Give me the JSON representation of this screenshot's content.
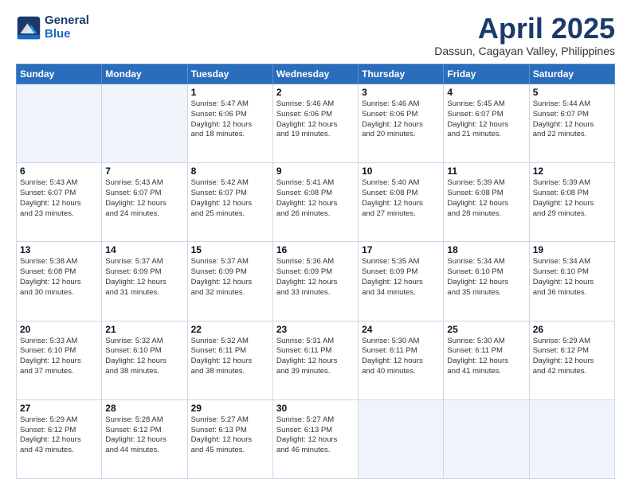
{
  "header": {
    "logo_line1": "General",
    "logo_line2": "Blue",
    "month": "April 2025",
    "location": "Dassun, Cagayan Valley, Philippines"
  },
  "weekdays": [
    "Sunday",
    "Monday",
    "Tuesday",
    "Wednesday",
    "Thursday",
    "Friday",
    "Saturday"
  ],
  "weeks": [
    [
      {
        "day": "",
        "info": ""
      },
      {
        "day": "",
        "info": ""
      },
      {
        "day": "1",
        "info": "Sunrise: 5:47 AM\nSunset: 6:06 PM\nDaylight: 12 hours\nand 18 minutes."
      },
      {
        "day": "2",
        "info": "Sunrise: 5:46 AM\nSunset: 6:06 PM\nDaylight: 12 hours\nand 19 minutes."
      },
      {
        "day": "3",
        "info": "Sunrise: 5:46 AM\nSunset: 6:06 PM\nDaylight: 12 hours\nand 20 minutes."
      },
      {
        "day": "4",
        "info": "Sunrise: 5:45 AM\nSunset: 6:07 PM\nDaylight: 12 hours\nand 21 minutes."
      },
      {
        "day": "5",
        "info": "Sunrise: 5:44 AM\nSunset: 6:07 PM\nDaylight: 12 hours\nand 22 minutes."
      }
    ],
    [
      {
        "day": "6",
        "info": "Sunrise: 5:43 AM\nSunset: 6:07 PM\nDaylight: 12 hours\nand 23 minutes."
      },
      {
        "day": "7",
        "info": "Sunrise: 5:43 AM\nSunset: 6:07 PM\nDaylight: 12 hours\nand 24 minutes."
      },
      {
        "day": "8",
        "info": "Sunrise: 5:42 AM\nSunset: 6:07 PM\nDaylight: 12 hours\nand 25 minutes."
      },
      {
        "day": "9",
        "info": "Sunrise: 5:41 AM\nSunset: 6:08 PM\nDaylight: 12 hours\nand 26 minutes."
      },
      {
        "day": "10",
        "info": "Sunrise: 5:40 AM\nSunset: 6:08 PM\nDaylight: 12 hours\nand 27 minutes."
      },
      {
        "day": "11",
        "info": "Sunrise: 5:39 AM\nSunset: 6:08 PM\nDaylight: 12 hours\nand 28 minutes."
      },
      {
        "day": "12",
        "info": "Sunrise: 5:39 AM\nSunset: 6:08 PM\nDaylight: 12 hours\nand 29 minutes."
      }
    ],
    [
      {
        "day": "13",
        "info": "Sunrise: 5:38 AM\nSunset: 6:08 PM\nDaylight: 12 hours\nand 30 minutes."
      },
      {
        "day": "14",
        "info": "Sunrise: 5:37 AM\nSunset: 6:09 PM\nDaylight: 12 hours\nand 31 minutes."
      },
      {
        "day": "15",
        "info": "Sunrise: 5:37 AM\nSunset: 6:09 PM\nDaylight: 12 hours\nand 32 minutes."
      },
      {
        "day": "16",
        "info": "Sunrise: 5:36 AM\nSunset: 6:09 PM\nDaylight: 12 hours\nand 33 minutes."
      },
      {
        "day": "17",
        "info": "Sunrise: 5:35 AM\nSunset: 6:09 PM\nDaylight: 12 hours\nand 34 minutes."
      },
      {
        "day": "18",
        "info": "Sunrise: 5:34 AM\nSunset: 6:10 PM\nDaylight: 12 hours\nand 35 minutes."
      },
      {
        "day": "19",
        "info": "Sunrise: 5:34 AM\nSunset: 6:10 PM\nDaylight: 12 hours\nand 36 minutes."
      }
    ],
    [
      {
        "day": "20",
        "info": "Sunrise: 5:33 AM\nSunset: 6:10 PM\nDaylight: 12 hours\nand 37 minutes."
      },
      {
        "day": "21",
        "info": "Sunrise: 5:32 AM\nSunset: 6:10 PM\nDaylight: 12 hours\nand 38 minutes."
      },
      {
        "day": "22",
        "info": "Sunrise: 5:32 AM\nSunset: 6:11 PM\nDaylight: 12 hours\nand 38 minutes."
      },
      {
        "day": "23",
        "info": "Sunrise: 5:31 AM\nSunset: 6:11 PM\nDaylight: 12 hours\nand 39 minutes."
      },
      {
        "day": "24",
        "info": "Sunrise: 5:30 AM\nSunset: 6:11 PM\nDaylight: 12 hours\nand 40 minutes."
      },
      {
        "day": "25",
        "info": "Sunrise: 5:30 AM\nSunset: 6:11 PM\nDaylight: 12 hours\nand 41 minutes."
      },
      {
        "day": "26",
        "info": "Sunrise: 5:29 AM\nSunset: 6:12 PM\nDaylight: 12 hours\nand 42 minutes."
      }
    ],
    [
      {
        "day": "27",
        "info": "Sunrise: 5:29 AM\nSunset: 6:12 PM\nDaylight: 12 hours\nand 43 minutes."
      },
      {
        "day": "28",
        "info": "Sunrise: 5:28 AM\nSunset: 6:12 PM\nDaylight: 12 hours\nand 44 minutes."
      },
      {
        "day": "29",
        "info": "Sunrise: 5:27 AM\nSunset: 6:13 PM\nDaylight: 12 hours\nand 45 minutes."
      },
      {
        "day": "30",
        "info": "Sunrise: 5:27 AM\nSunset: 6:13 PM\nDaylight: 12 hours\nand 46 minutes."
      },
      {
        "day": "",
        "info": ""
      },
      {
        "day": "",
        "info": ""
      },
      {
        "day": "",
        "info": ""
      }
    ]
  ]
}
